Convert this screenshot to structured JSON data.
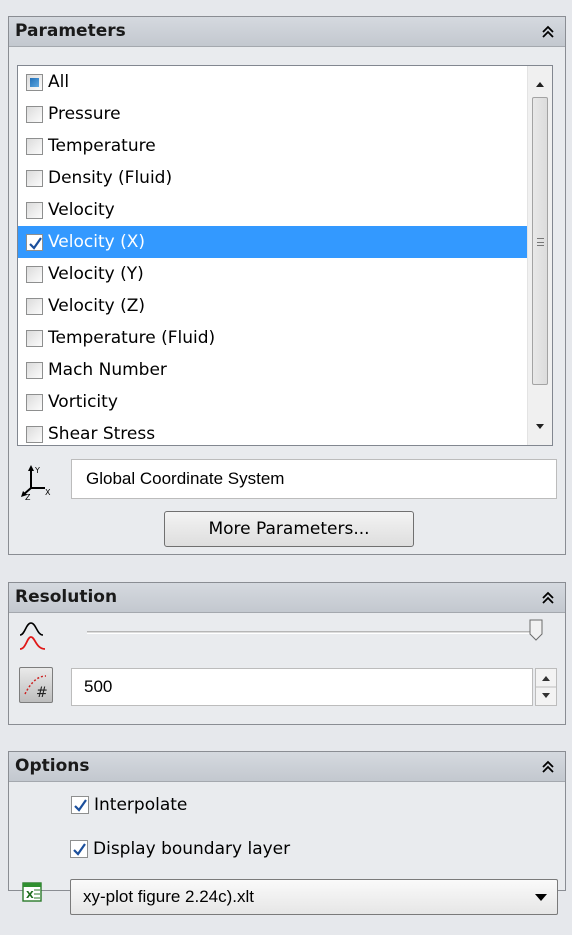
{
  "parameters": {
    "title": "Parameters",
    "items": [
      {
        "label": "All",
        "state": "partial"
      },
      {
        "label": "Pressure",
        "state": "unchecked"
      },
      {
        "label": "Temperature",
        "state": "unchecked"
      },
      {
        "label": "Density (Fluid)",
        "state": "unchecked"
      },
      {
        "label": "Velocity",
        "state": "unchecked"
      },
      {
        "label": "Velocity (X)",
        "state": "checked",
        "selected": true
      },
      {
        "label": "Velocity (Y)",
        "state": "unchecked"
      },
      {
        "label": "Velocity (Z)",
        "state": "unchecked"
      },
      {
        "label": "Temperature (Fluid)",
        "state": "unchecked"
      },
      {
        "label": "Mach Number",
        "state": "unchecked"
      },
      {
        "label": "Vorticity",
        "state": "unchecked"
      },
      {
        "label": "Shear Stress",
        "state": "unchecked"
      }
    ],
    "coordinate_system": "Global Coordinate System",
    "more_button": "More Parameters..."
  },
  "resolution": {
    "title": "Resolution",
    "slider_level": 1.0,
    "points_value": "500"
  },
  "options": {
    "title": "Options",
    "interpolate_label": "Interpolate",
    "interpolate_checked": true,
    "boundary_label": "Display boundary layer",
    "boundary_checked": true,
    "template_file": "xy-plot figure 2.24c).xlt"
  },
  "colors": {
    "selection": "#3399ff",
    "header_gradient_top": "#d5d9df",
    "header_gradient_bottom": "#c3c8cf"
  }
}
